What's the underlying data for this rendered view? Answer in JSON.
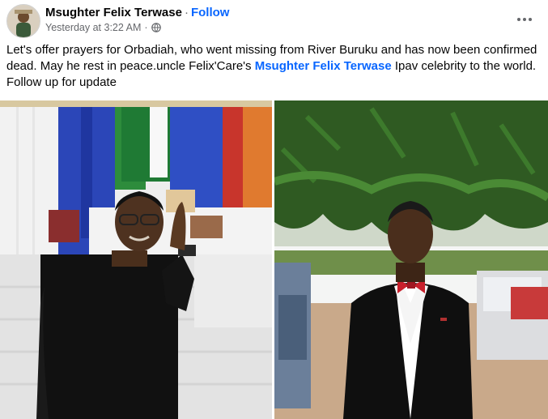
{
  "post": {
    "author": "Msughter Felix Terwase",
    "separator": "·",
    "follow_label": "Follow",
    "timestamp": "Yesterday at 3:22 AM",
    "timestamp_separator": "·",
    "audience_icon": "globe-icon",
    "more_icon": "more-options-icon",
    "text_part1": "Let's offer prayers for Orbadiah, who went missing from River Buruku and has now been confirmed dead. May he rest in peace.uncle Felix'Care's ",
    "mention": "Msughter Felix Terwase",
    "text_part2": " Ipav celebrity to the world. Follow up for update"
  },
  "colors": {
    "link": "#0866ff",
    "meta": "#65676b",
    "text": "#050505"
  }
}
